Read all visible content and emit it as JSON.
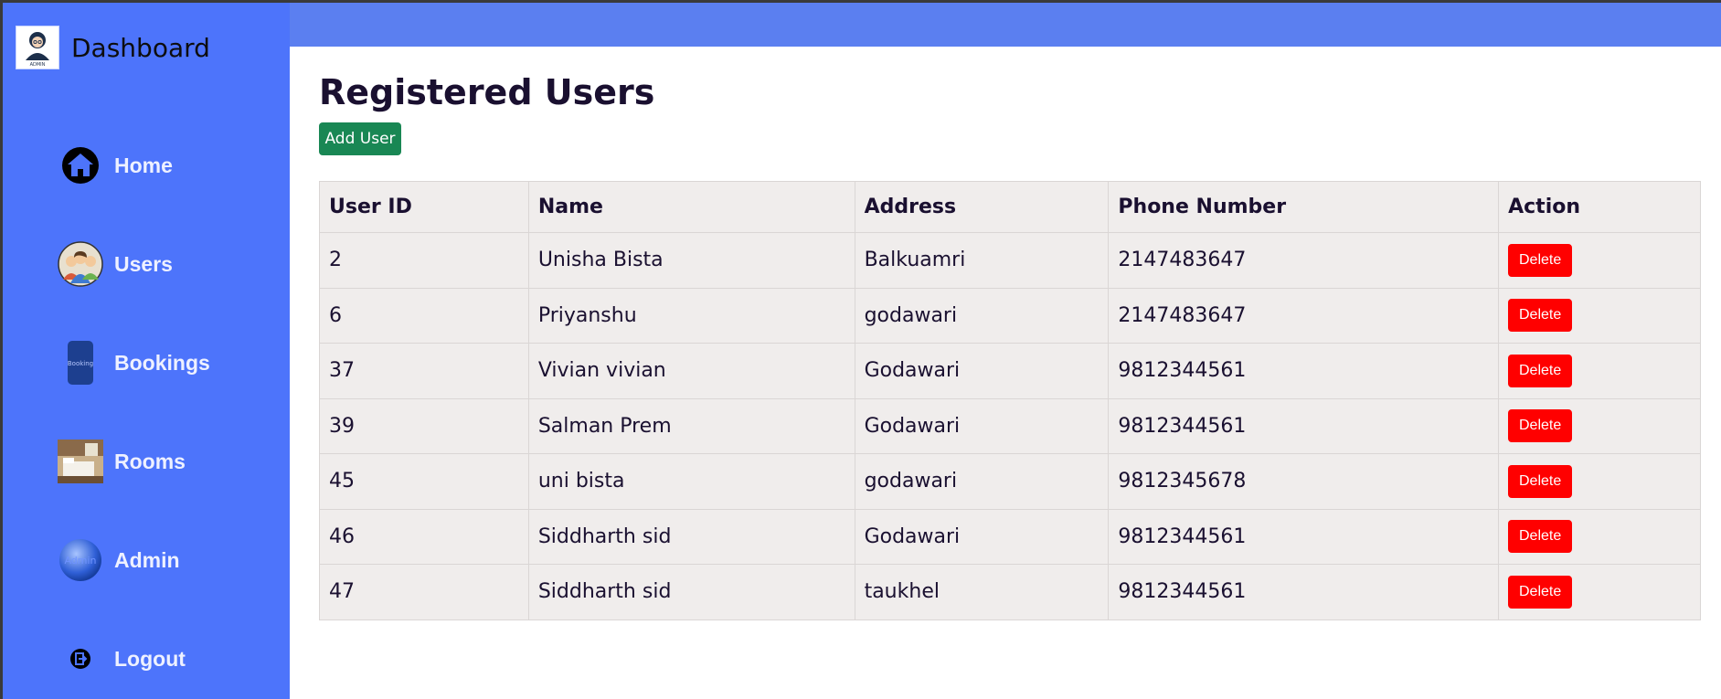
{
  "sidebar": {
    "brand_title": "Dashboard",
    "brand_logo_text": "ADMIN",
    "items": [
      {
        "label": "Home",
        "icon": "home-icon"
      },
      {
        "label": "Users",
        "icon": "users-icon"
      },
      {
        "label": "Bookings",
        "icon": "bookings-icon",
        "icon_text": "Booking"
      },
      {
        "label": "Rooms",
        "icon": "rooms-icon"
      },
      {
        "label": "Admin",
        "icon": "admin-icon",
        "icon_text": "Admin"
      },
      {
        "label": "Logout",
        "icon": "logout-icon"
      }
    ]
  },
  "main": {
    "title": "Registered Users",
    "add_button": "Add User",
    "table": {
      "headers": [
        "User ID",
        "Name",
        "Address",
        "Phone Number",
        "Action"
      ],
      "rows": [
        {
          "id": "2",
          "name": "Unisha Bista",
          "address": "Balkuamri",
          "phone": "2147483647",
          "action": "Delete"
        },
        {
          "id": "6",
          "name": "Priyanshu",
          "address": "godawari",
          "phone": "2147483647",
          "action": "Delete"
        },
        {
          "id": "37",
          "name": "Vivian vivian",
          "address": "Godawari",
          "phone": "9812344561",
          "action": "Delete"
        },
        {
          "id": "39",
          "name": "Salman Prem",
          "address": "Godawari",
          "phone": "9812344561",
          "action": "Delete"
        },
        {
          "id": "45",
          "name": "uni bista",
          "address": "godawari",
          "phone": "9812345678",
          "action": "Delete"
        },
        {
          "id": "46",
          "name": "Siddharth sid",
          "address": "Godawari",
          "phone": "9812344561",
          "action": "Delete"
        },
        {
          "id": "47",
          "name": "Siddharth sid",
          "address": "taukhel",
          "phone": "9812344561",
          "action": "Delete"
        }
      ]
    }
  },
  "colors": {
    "sidebar_bg": "#4d74fb",
    "topbar_bg": "#5b7ff0",
    "add_button_bg": "#198754",
    "delete_button_bg": "#ff0000",
    "table_bg": "#f0edec"
  }
}
